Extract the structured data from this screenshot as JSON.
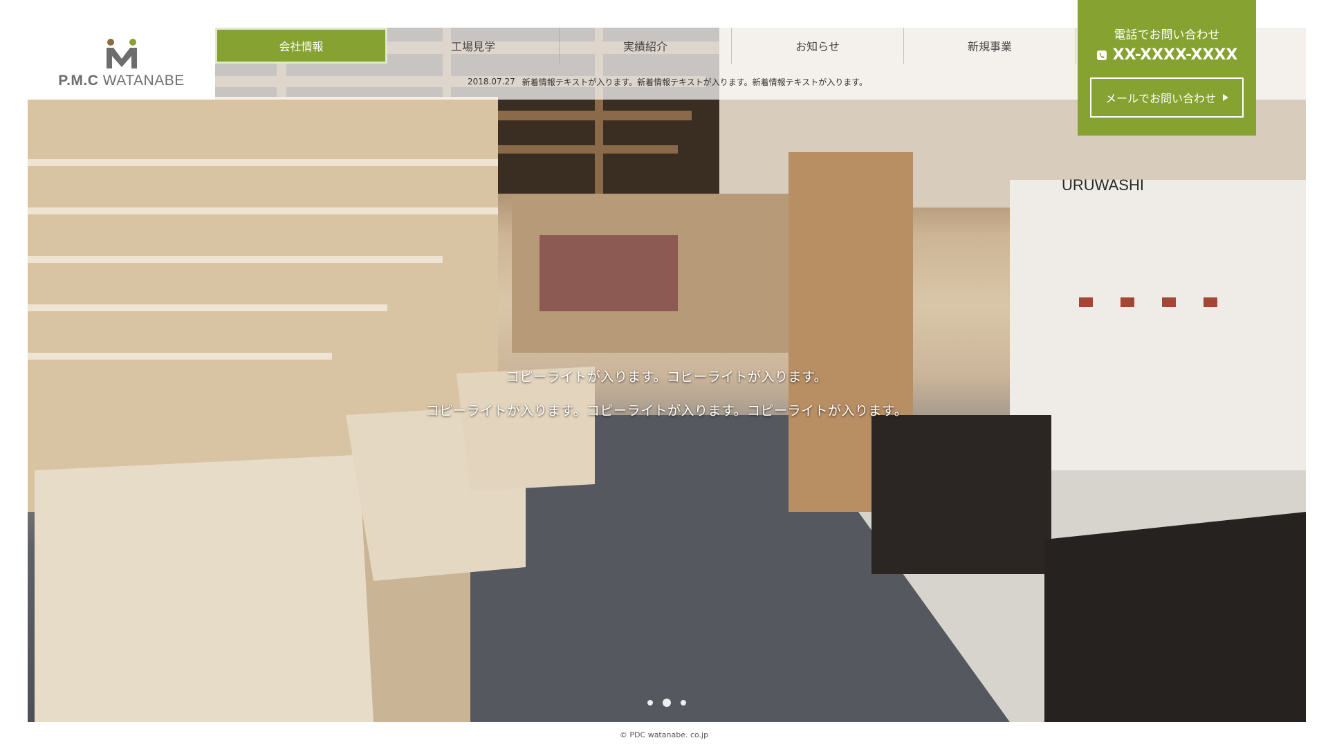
{
  "logo": {
    "mark_letter": "M",
    "brand_prefix": "P.M.C",
    "brand_name": "WATANABE"
  },
  "nav": {
    "items": [
      {
        "label": "会社情報",
        "active": true
      },
      {
        "label": "工場見学",
        "active": false
      },
      {
        "label": "実績紹介",
        "active": false
      },
      {
        "label": "お知らせ",
        "active": false
      },
      {
        "label": "新規事業",
        "active": false
      }
    ]
  },
  "news": {
    "date": "2018.07.27",
    "text": "新着情報テキストが入ります。新着情報テキストが入ります。新着情報テキストが入ります。"
  },
  "contact": {
    "phone_title": "電話でお問い合わせ",
    "phone_number": "XX-XXXX-XXXX",
    "mail_button": "メールでお問い合わせ"
  },
  "hero": {
    "captions": [
      "コピーライトが入ります。コピーライトが入ります。",
      "コピーライトが入ります。コピーライトが入ります。コピーライトが入ります。"
    ],
    "slide_count": 3,
    "active_slide": 2,
    "store_sign": "URUWASHI"
  },
  "footer": {
    "copyright": "© PDC watanabe. co.jp"
  },
  "colors": {
    "accent": "#86a231",
    "logo_gray": "#6d6d6d",
    "logo_brown": "#8b6a3e",
    "logo_green": "#86a231"
  }
}
